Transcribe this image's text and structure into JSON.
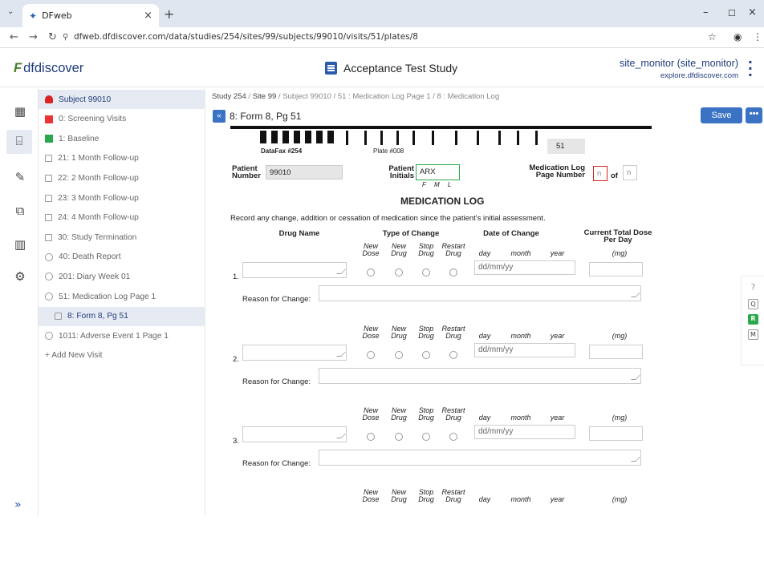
{
  "browser": {
    "tab_title": "DFweb",
    "url": "dfweb.dfdiscover.com/data/studies/254/sites/99/subjects/99010/visits/51/plates/8"
  },
  "app": {
    "logo": "dfdiscover",
    "study_title": "Acceptance Test Study",
    "user": "site_monitor (site_monitor)",
    "server": "explore.dfdiscover.com"
  },
  "sidebar": {
    "items": [
      {
        "label": "Subject 99010",
        "marker": "person"
      },
      {
        "label": "0: Screening Visits",
        "marker": "flag-red"
      },
      {
        "label": "1: Baseline",
        "marker": "flag-green"
      },
      {
        "label": "21: 1 Month Follow-up",
        "marker": "box"
      },
      {
        "label": "22: 2 Month Follow-up",
        "marker": "box"
      },
      {
        "label": "23: 3 Month Follow-up",
        "marker": "box"
      },
      {
        "label": "24: 4 Month Follow-up",
        "marker": "box"
      },
      {
        "label": "30: Study Termination",
        "marker": "box"
      },
      {
        "label": "40: Death Report",
        "marker": "circ"
      },
      {
        "label": "201: Diary Week 01",
        "marker": "circ"
      },
      {
        "label": "51: Medication Log Page 1",
        "marker": "circ"
      },
      {
        "label": "8: Form 8, Pg 51",
        "marker": "box"
      },
      {
        "label": "1011: Adverse Event 1 Page 1",
        "marker": "circ"
      },
      {
        "label": "+ Add New Visit",
        "marker": "none"
      }
    ]
  },
  "breadcrumb": {
    "study": "Study 254",
    "site": "Site 99",
    "subject": "Subject 99010",
    "visit": "51 : Medication Log Page 1",
    "plate": "8 : Medication Log"
  },
  "form": {
    "title": "8: Form 8, Pg 51",
    "save": "Save",
    "more": "•••",
    "datafax": "DataFax #254",
    "plate": "Plate #008",
    "page_no": "51",
    "patient_number_label": "Patient Number",
    "patient_number": "99010",
    "patient_initials_label": "Patient Initials",
    "patient_initials": "ARX",
    "fml": "F M L",
    "medlog_label": "Medication Log Page Number",
    "medlog_page": "n",
    "of": "of",
    "medlog_total": "n",
    "heading": "MEDICATION LOG",
    "instructions": "Record any change, addition or cessation of medication since the patient's initial assessment.",
    "col_drug": "Drug Name",
    "col_type": "Type of Change",
    "col_date": "Date of Change",
    "col_dose": "Current Total Dose Per Day",
    "opt_new_dose": "New Dose",
    "opt_new_drug": "New Drug",
    "opt_stop_drug": "Stop Drug",
    "opt_restart_drug": "Restart Drug",
    "day": "day",
    "month": "month",
    "year": "year",
    "mg": "(mg)",
    "date_placeholder": "dd/mm/yy",
    "reason_label": "Reason for Change:",
    "rows": [
      "1.",
      "2.",
      "3."
    ]
  },
  "right_panel": {
    "help": "?",
    "q": "Q",
    "r": "R",
    "m": "M"
  }
}
